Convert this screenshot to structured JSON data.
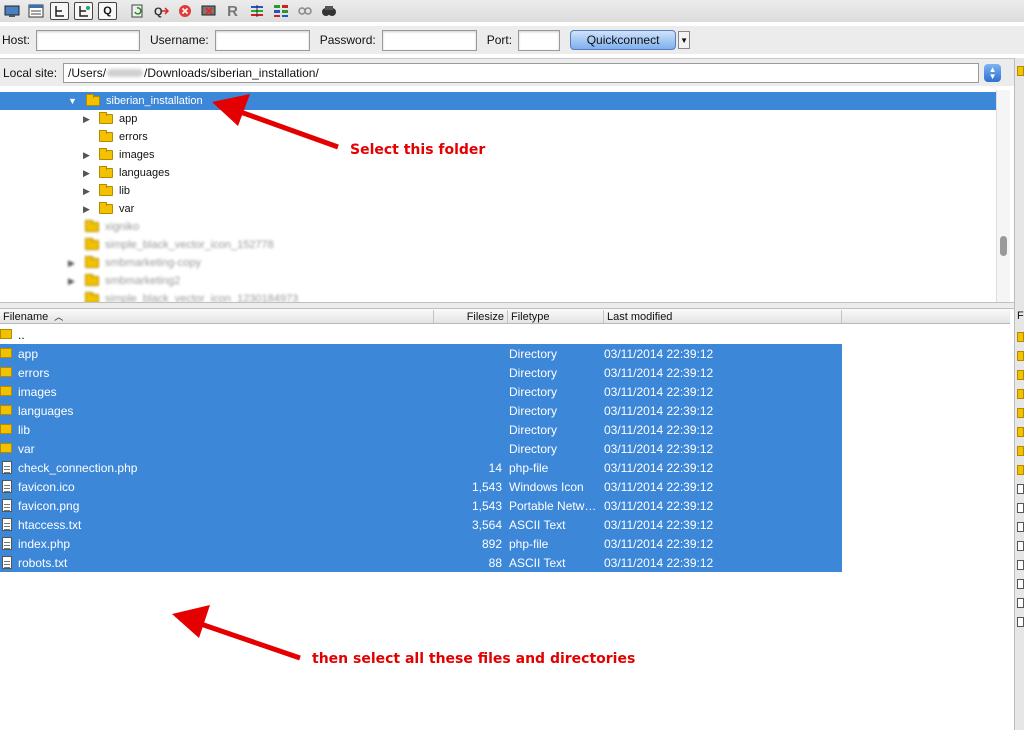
{
  "toolbar": {
    "icons": [
      "site-manager-icon",
      "message-log-icon",
      "local-tree-icon",
      "remote-tree-icon",
      "queue-icon",
      "refresh-icon",
      "process-queue-icon",
      "cancel-icon",
      "disconnect-icon",
      "reconnect-icon",
      "filter-icon",
      "compare-icon",
      "sync-browse-icon",
      "search-icon"
    ],
    "queue_glyph": "Q",
    "reconnect_glyph": "R"
  },
  "quickconnect": {
    "host_label": "Host:",
    "host_value": "",
    "username_label": "Username:",
    "username_value": "",
    "password_label": "Password:",
    "password_value": "",
    "port_label": "Port:",
    "port_value": "",
    "button_label": "Quickconnect"
  },
  "local_site": {
    "label": "Local site:",
    "path_prefix": "/Users/",
    "path_suffix": "/Downloads/siberian_installation/"
  },
  "tree": {
    "selected": "siberian_installation",
    "children": [
      "app",
      "errors",
      "images",
      "languages",
      "lib",
      "var"
    ],
    "children_expandable": [
      true,
      false,
      true,
      true,
      true,
      true
    ],
    "blurred": [
      "xigniko",
      "simple_black_vector_icon_152778",
      "smbmarketing-copy",
      "smbmarketing2",
      "simple_black_vector_icon_1230184973"
    ]
  },
  "file_list": {
    "columns": {
      "filename": "Filename",
      "filesize": "Filesize",
      "filetype": "Filetype",
      "modified": "Last modified"
    },
    "parent_dir": "..",
    "rows": [
      {
        "name": "app",
        "size": "",
        "type": "Directory",
        "modified": "03/11/2014 22:39:12",
        "kind": "dir"
      },
      {
        "name": "errors",
        "size": "",
        "type": "Directory",
        "modified": "03/11/2014 22:39:12",
        "kind": "dir"
      },
      {
        "name": "images",
        "size": "",
        "type": "Directory",
        "modified": "03/11/2014 22:39:12",
        "kind": "dir"
      },
      {
        "name": "languages",
        "size": "",
        "type": "Directory",
        "modified": "03/11/2014 22:39:12",
        "kind": "dir"
      },
      {
        "name": "lib",
        "size": "",
        "type": "Directory",
        "modified": "03/11/2014 22:39:12",
        "kind": "dir"
      },
      {
        "name": "var",
        "size": "",
        "type": "Directory",
        "modified": "03/11/2014 22:39:12",
        "kind": "dir"
      },
      {
        "name": "check_connection.php",
        "size": "14",
        "type": "php-file",
        "modified": "03/11/2014 22:39:12",
        "kind": "doc"
      },
      {
        "name": "favicon.ico",
        "size": "1,543",
        "type": "Windows Icon",
        "modified": "03/11/2014 22:39:12",
        "kind": "doc"
      },
      {
        "name": "favicon.png",
        "size": "1,543",
        "type": "Portable Netw…",
        "modified": "03/11/2014 22:39:12",
        "kind": "doc"
      },
      {
        "name": "htaccess.txt",
        "size": "3,564",
        "type": "ASCII Text",
        "modified": "03/11/2014 22:39:12",
        "kind": "doc"
      },
      {
        "name": "index.php",
        "size": "892",
        "type": "php-file",
        "modified": "03/11/2014 22:39:12",
        "kind": "doc"
      },
      {
        "name": "robots.txt",
        "size": "88",
        "type": "ASCII Text",
        "modified": "03/11/2014 22:39:12",
        "kind": "doc"
      }
    ]
  },
  "remote_pane": {
    "header_letter": "F"
  },
  "annotations": {
    "select_folder": "Select this folder",
    "select_all": "then select all these files and directories",
    "color": "#e40000"
  },
  "colors": {
    "selection": "#3d87d9",
    "quickconnect_button": "#7fb0ee"
  }
}
